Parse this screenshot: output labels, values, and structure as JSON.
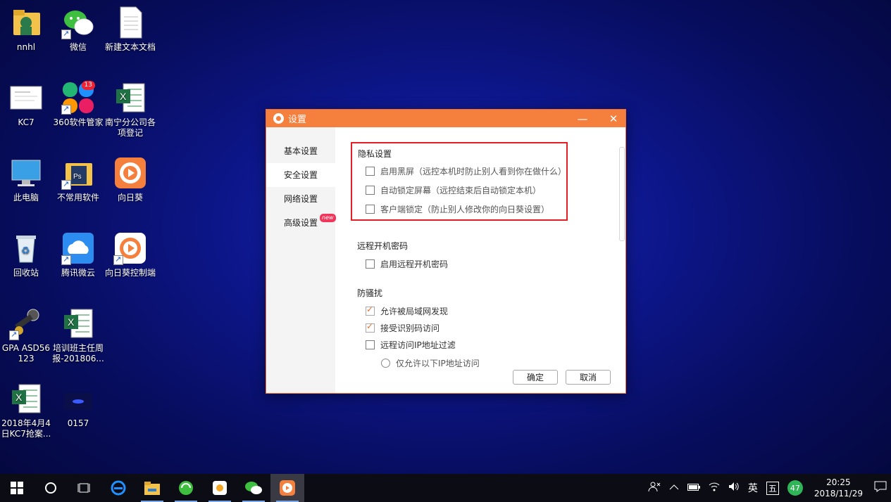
{
  "desktop_icons": [
    {
      "name": "nnhl"
    },
    {
      "name": "微信"
    },
    {
      "name": "新建文本文档"
    },
    {
      "name": "KC7"
    },
    {
      "name": "360软件管家",
      "badge": "13"
    },
    {
      "name": "南宁分公司各项登记"
    },
    {
      "name": "此电脑"
    },
    {
      "name": "不常用软件"
    },
    {
      "name": "向日葵"
    },
    {
      "name": "回收站"
    },
    {
      "name": "腾讯微云"
    },
    {
      "name": "向日葵控制端"
    },
    {
      "name": "GPA ASD56123"
    },
    {
      "name": "培训班主任周报-201806..."
    },
    {
      "name": "2018年4月4日KC7抢案..."
    },
    {
      "name": "0157"
    }
  ],
  "window": {
    "title": "设置",
    "minimize": "—",
    "close": "✕",
    "nav": [
      {
        "label": "基本设置"
      },
      {
        "label": "安全设置"
      },
      {
        "label": "网络设置"
      },
      {
        "label": "高级设置",
        "tag": "new"
      }
    ],
    "privacy": {
      "title": "隐私设置",
      "options": [
        {
          "label": "启用黑屏（远控本机时防止别人看到你在做什么）",
          "checked": false
        },
        {
          "label": "自动锁定屏幕（远控结束后自动锁定本机）",
          "checked": false
        },
        {
          "label": "客户端锁定（防止别人修改你的向日葵设置）",
          "checked": false
        }
      ]
    },
    "remote_boot": {
      "title": "远程开机密码",
      "option": "启用远程开机密码"
    },
    "anti_harass": {
      "title": "防骚扰",
      "options": [
        {
          "label": "允许被局域网发现",
          "checked": true
        },
        {
          "label": "接受识别码访问",
          "checked": true
        },
        {
          "label": "远程访问IP地址过滤",
          "checked": false
        }
      ],
      "radio": "仅允许以下IP地址访问"
    },
    "ok_label": "确定",
    "cancel_label": "取消"
  },
  "taskbar": {
    "tray_ime_lang": "英",
    "tray_ime_mode": "五",
    "tray_badge": "47",
    "time": "20:25",
    "date": "2018/11/29"
  },
  "colors": {
    "accent": "#f57f3d",
    "highlight_box": "#e41e26",
    "desktop_bg": "#0d168a"
  }
}
